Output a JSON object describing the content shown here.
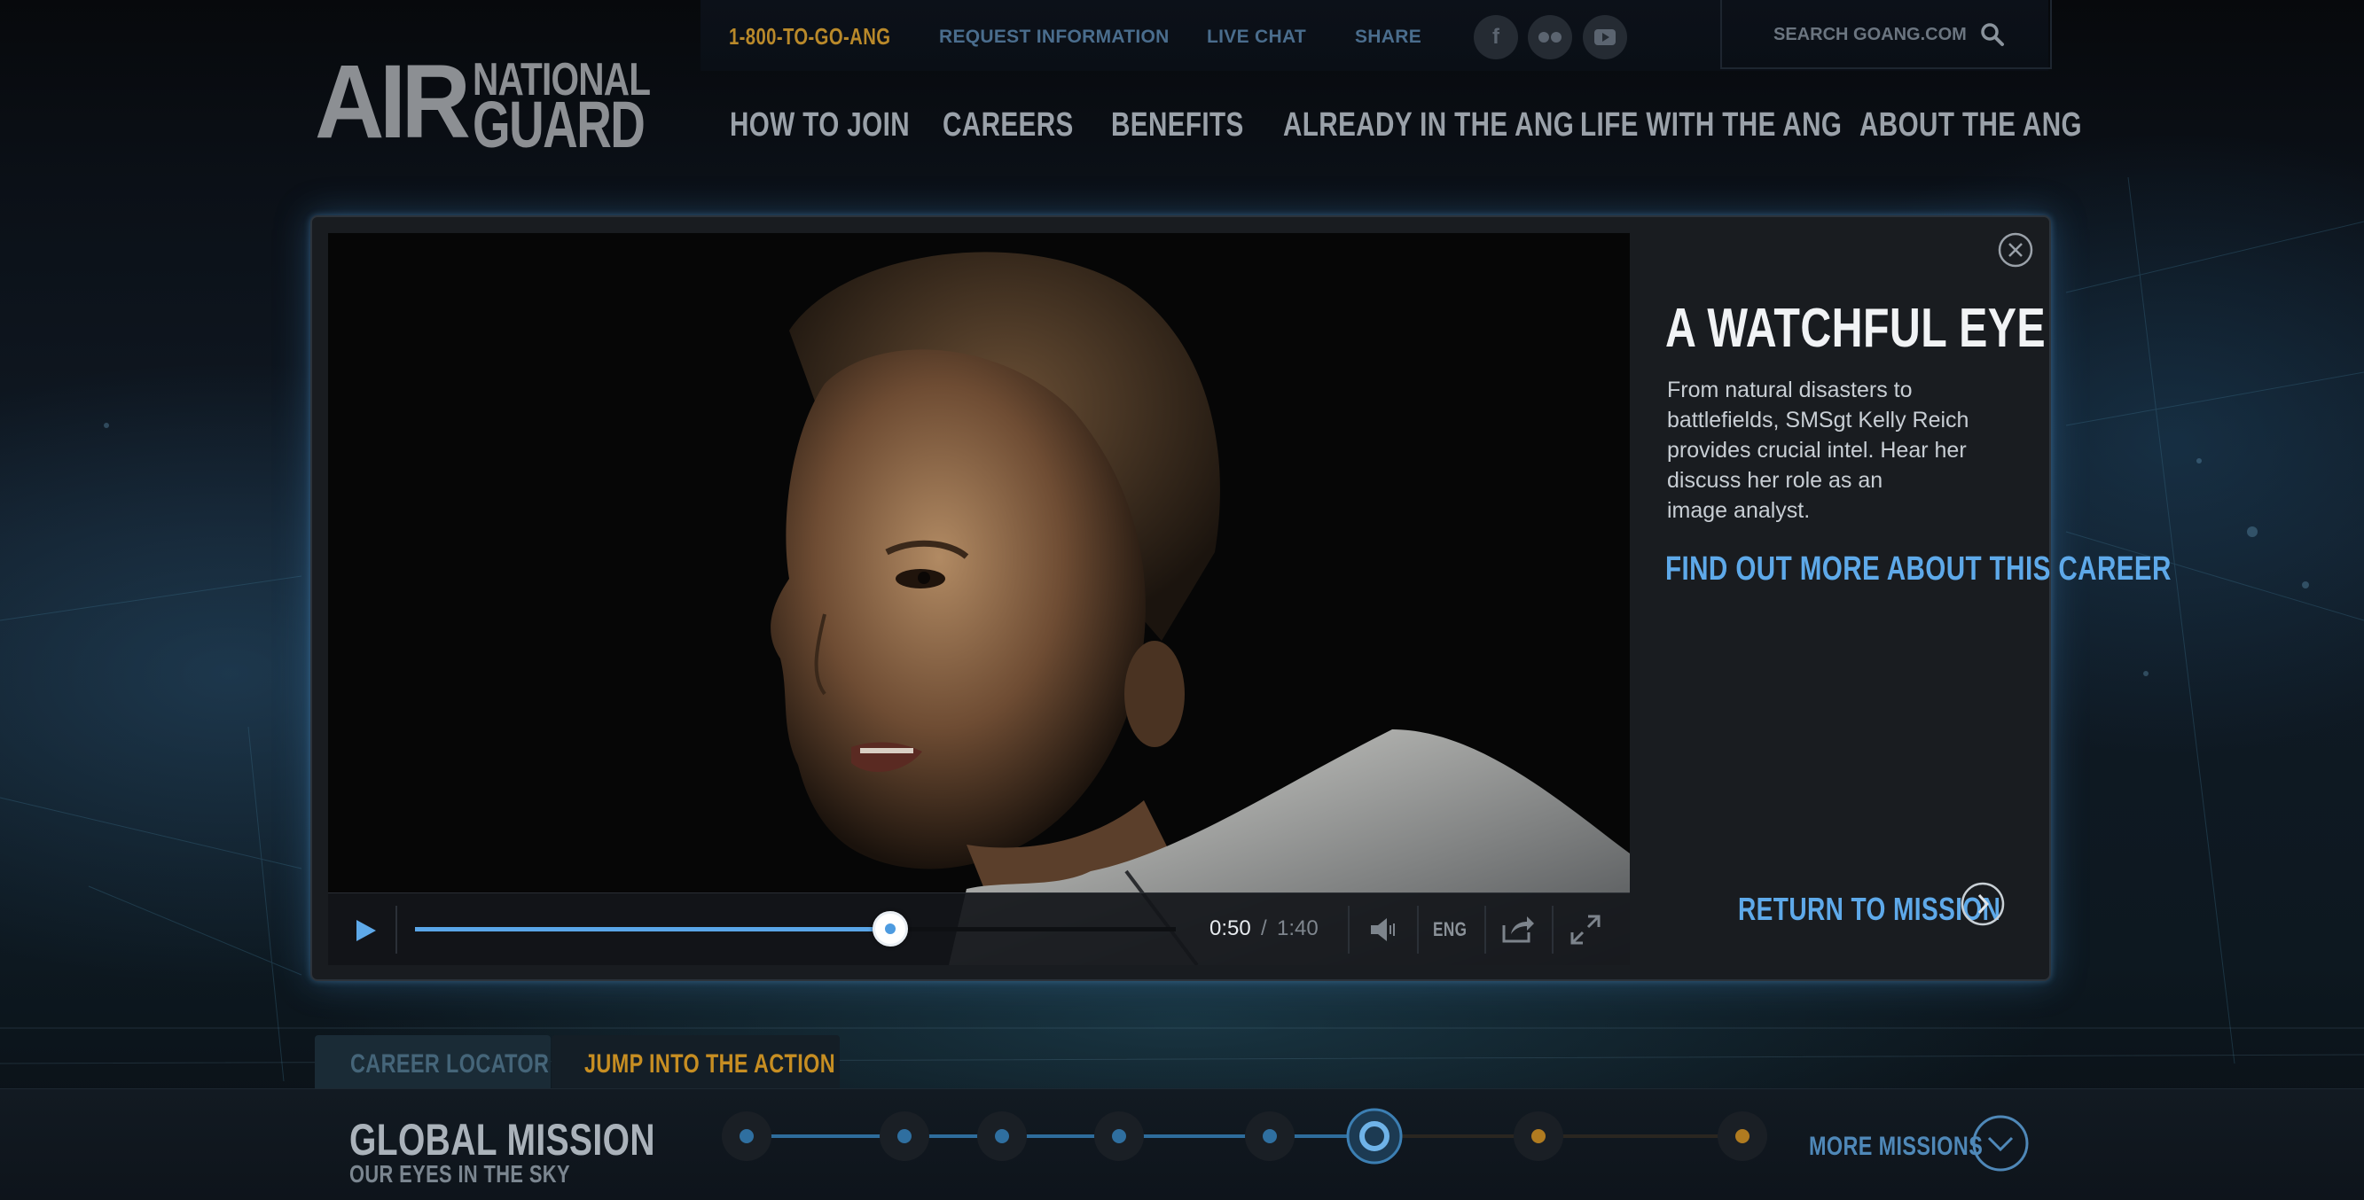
{
  "utility": {
    "phone": "1-800-TO-GO-ANG",
    "request_info": "REQUEST INFORMATION",
    "live_chat": "LIVE CHAT",
    "share": "SHARE",
    "search_label": "SEARCH GOANG.COM"
  },
  "logo": {
    "air": "AIR",
    "national": "NATIONAL",
    "guard": "GUARD"
  },
  "nav": {
    "how_to_join": "HOW TO JOIN",
    "careers": "CAREERS",
    "benefits": "BENEFITS",
    "already": "ALREADY IN THE ANG",
    "life": "LIFE WITH THE ANG",
    "about": "ABOUT THE ANG"
  },
  "video": {
    "current_time": "0:50",
    "separator": "/",
    "total_time": "1:40",
    "progress_fraction": 0.5,
    "language": "ENG"
  },
  "panel": {
    "title": "A WATCHFUL EYE",
    "description_lines": [
      "From natural disasters to",
      "battlefields, SMSgt Kelly Reich",
      "provides crucial intel. Hear her",
      "discuss her role as an",
      "image analyst."
    ],
    "find_out_more": "FIND OUT MORE ABOUT THIS CAREER",
    "return": "RETURN TO MISSION"
  },
  "tabs": {
    "career_locator": "CAREER LOCATOR",
    "jump": "JUMP INTO THE ACTION"
  },
  "mission": {
    "title": "GLOBAL MISSION",
    "subtitle": "OUR EYES IN THE SKY",
    "more": "MORE MISSIONS",
    "active_index": 5,
    "completed_count": 5,
    "total_nodes": 8
  },
  "colors": {
    "accent_blue": "#5ea9e9",
    "accent_gold": "#c78e22"
  }
}
